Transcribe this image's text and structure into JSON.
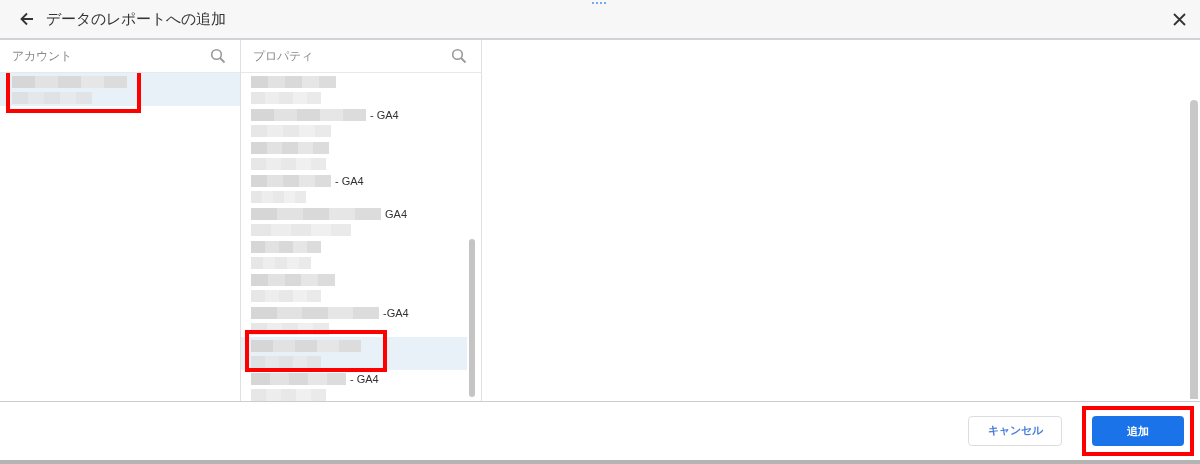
{
  "dialog": {
    "title": "データのレポートへの追加"
  },
  "columns": [
    {
      "header": "アカウント",
      "items": [
        {
          "selected": true,
          "highlighted": true
        }
      ]
    },
    {
      "header": "プロパティ",
      "items": [
        {
          "selected": false,
          "highlighted": false
        },
        {
          "suffix": "- GA4",
          "selected": false,
          "highlighted": false
        },
        {
          "selected": false,
          "highlighted": false
        },
        {
          "suffix": "- GA4",
          "selected": false,
          "highlighted": false
        },
        {
          "suffix": "GA4",
          "selected": false,
          "highlighted": false
        },
        {
          "selected": false,
          "highlighted": false
        },
        {
          "selected": false,
          "highlighted": false
        },
        {
          "suffix": "-GA4",
          "selected": false,
          "highlighted": false
        },
        {
          "selected": true,
          "highlighted": true
        },
        {
          "suffix": "- GA4",
          "selected": false,
          "highlighted": false
        }
      ]
    }
  ],
  "buttons": [
    {
      "label": "キャンセル",
      "kind": "secondary",
      "highlighted": false
    },
    {
      "label": "追加",
      "kind": "primary",
      "highlighted": true
    }
  ]
}
